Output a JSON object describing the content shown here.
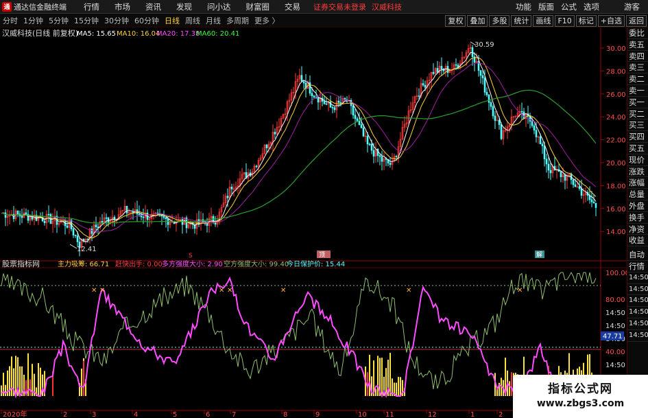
{
  "titlebar": {
    "app_title": "通达信金融终端",
    "menus": [
      "行情",
      "市场",
      "资讯",
      "发现",
      "问小达",
      "财富圈",
      "交易"
    ],
    "notice_left": "证券交易未登录",
    "notice_right": "汉威科技",
    "right_menus": [
      "功能",
      "版面",
      "公式",
      "选项"
    ],
    "guest": "游客"
  },
  "periods": [
    "分时",
    "1分钟",
    "5分钟",
    "15分钟",
    "30分钟",
    "60分钟",
    "日线",
    "周线",
    "月线",
    "多周期",
    "更多 〉"
  ],
  "active_period": "日线",
  "toolbar": [
    "复权",
    "叠加",
    "多股",
    "统计",
    "画线",
    "F10",
    "标记",
    "+自选",
    "返回"
  ],
  "main_chart": {
    "title": "汉威科技(日线 前复权)",
    "ma_labels": [
      {
        "text": "MA5: 15.65",
        "color": "#ffffff"
      },
      {
        "text": "MA10: 16.04",
        "color": "#ffd23c"
      },
      {
        "text": "MA20: 17.38",
        "color": "#ff4cff"
      },
      {
        "text": "MA60: 20.41",
        "color": "#3cff3c"
      }
    ],
    "y_ticks": [
      "30.00",
      "28.00",
      "26.00",
      "24.00",
      "22.00",
      "20.00",
      "18.00",
      "16.00",
      "14.00"
    ],
    "high_label": "30.59",
    "low_label": "12.41",
    "marker_ding": "顶",
    "marker_jie": "解",
    "marker_s": "S",
    "colors": {
      "up": "#ff3c3c",
      "down": "#54ffff",
      "ma60": "#2f9f2f",
      "ma20": "#a020a0"
    }
  },
  "indicator": {
    "name": "股票指标网",
    "labels": [
      {
        "text": "主力吸筹: 66.71",
        "color": "#ffd23c"
      },
      {
        "text": "赶快出手: 0.00",
        "color": "#ff3c3c"
      },
      {
        "text": "多方强度大小: 2.90",
        "color": "#ff4cff"
      },
      {
        "text": "空方强度大小: 99.40",
        "color": "#8fbf6f"
      },
      {
        "text": "今日保护价: 15.44",
        "color": "#54ffff"
      }
    ],
    "y_ticks": [
      "100.00",
      "80.00",
      "14:50",
      "14:50",
      "14:50",
      "40.00",
      "14:50",
      "14:50",
      "14:50"
    ],
    "current_value": "47.71",
    "cross_marker": "✕"
  },
  "x_axis": {
    "labels": [
      "2020年",
      "2",
      "3",
      "4",
      "5",
      "6",
      "7",
      "8",
      "9",
      "10",
      "11",
      "12",
      "1",
      "2",
      "3"
    ]
  },
  "side_panel": {
    "items": [
      "委比",
      "卖五",
      "卖四",
      "卖三",
      "卖二",
      "卖一",
      "买一",
      "买二",
      "买三",
      "买四",
      "买五",
      "现价",
      "涨跌",
      "涨幅",
      "总量",
      "外盘",
      "换手",
      "净资",
      "收益"
    ],
    "items2": [
      "自动",
      "行情"
    ],
    "items3": [
      "14:50",
      "14:50",
      "14:50",
      "14:50",
      "14:50",
      "14:50"
    ]
  },
  "watermark": {
    "title": "指标公式网",
    "url": "www.zbgs3.com"
  }
}
